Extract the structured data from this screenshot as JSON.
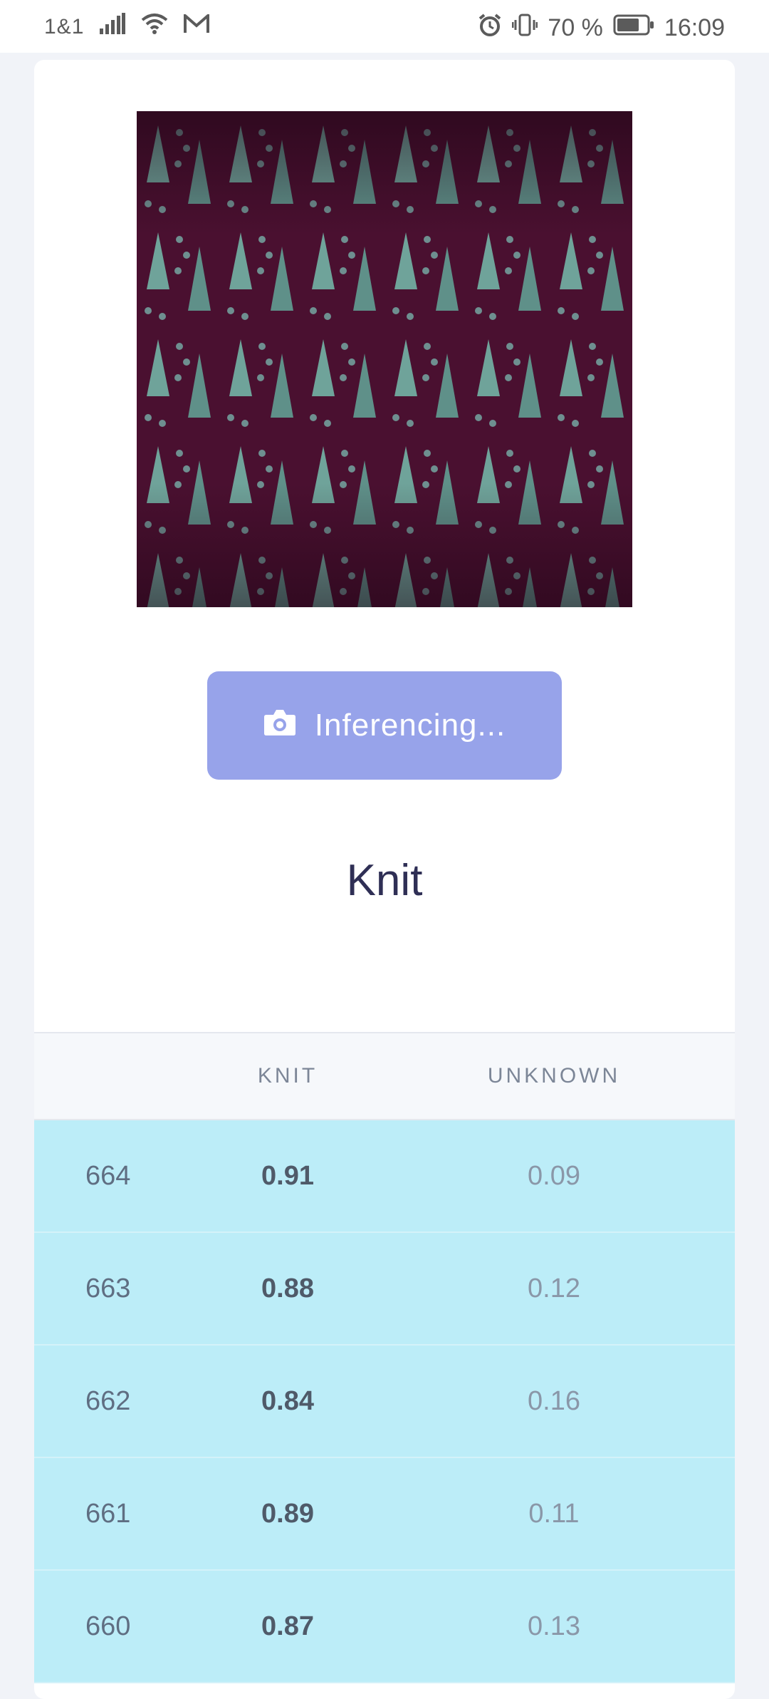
{
  "status_bar": {
    "carrier": "1&1",
    "battery": "70 %",
    "time": "16:09"
  },
  "camera": {
    "image_description_icon": "knit-photo"
  },
  "inference_button": {
    "label": "Inferencing..."
  },
  "result": {
    "label": "Knit"
  },
  "table": {
    "headers": [
      "",
      "KNIT",
      "UNKNOWN"
    ],
    "rows": [
      {
        "id": "664",
        "knit": "0.91",
        "unknown": "0.09"
      },
      {
        "id": "663",
        "knit": "0.88",
        "unknown": "0.12"
      },
      {
        "id": "662",
        "knit": "0.84",
        "unknown": "0.16"
      },
      {
        "id": "661",
        "knit": "0.89",
        "unknown": "0.11"
      },
      {
        "id": "660",
        "knit": "0.87",
        "unknown": "0.13"
      }
    ]
  },
  "colors": {
    "button": "#97a3ea",
    "row_highlight": "#bcedf8",
    "title": "#2f2f55"
  }
}
